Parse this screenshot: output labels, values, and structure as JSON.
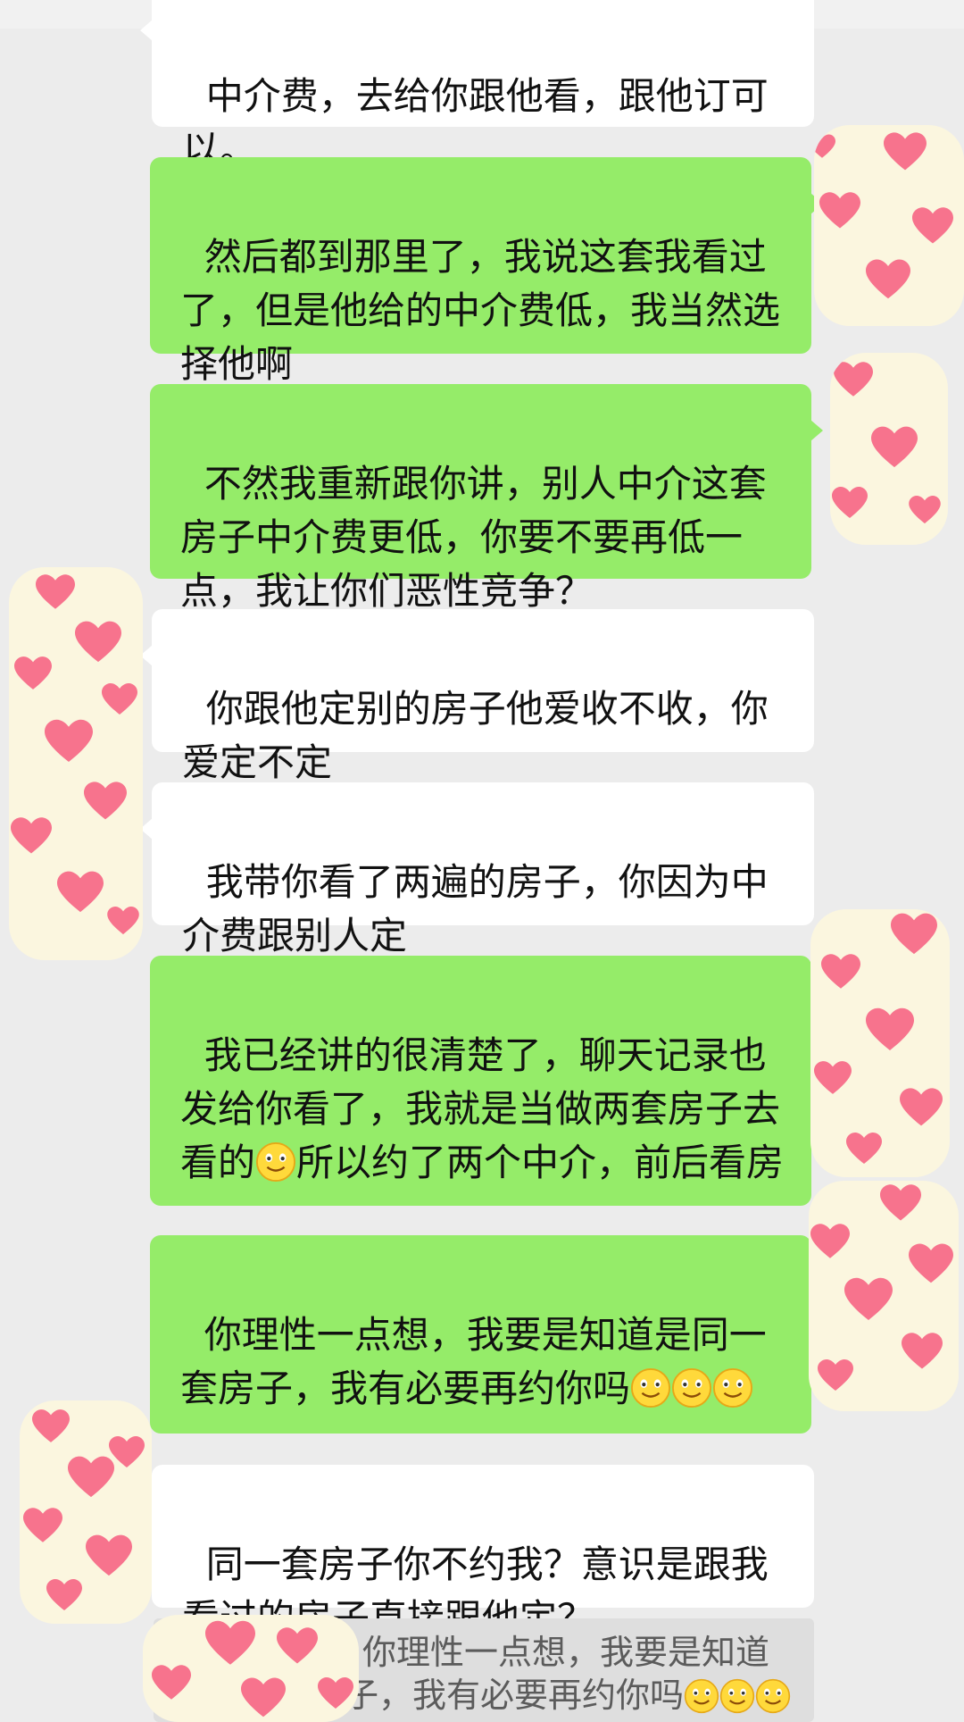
{
  "messages": [
    {
      "side": "left",
      "text": "中介费，去给你跟他看，跟他订可以。"
    },
    {
      "side": "right",
      "text": "然后都到那里了，我说这套我看过了，但是他给的中介费低，我当然选择他啊"
    },
    {
      "side": "right",
      "text": "不然我重新跟你讲，别人中介这套房子中介费更低，你要不要再低一点，我让你们恶性竞争？"
    },
    {
      "side": "left",
      "text": "你跟他定别的房子他爱收不收，你爱定不定"
    },
    {
      "side": "left",
      "text": "我带你看了两遍的房子，你因为中介费跟别人定"
    },
    {
      "side": "right",
      "text_before_emoji": "我已经讲的很清楚了，聊天记录也发给你看了，我就是当做两套房子去看的",
      "text_after_emoji": "所以约了两个中介，前后看房"
    },
    {
      "side": "right",
      "text": "你理性一点想，我要是知道是同一套房子，我有必要再约你吗"
    },
    {
      "side": "left",
      "text": "同一套房子你不约我？意识是跟我看过的房子直接跟他定？"
    }
  ],
  "quote": {
    "line1": "你理性一点想，我要是知道",
    "line2": "是同一套房子，我有必要再约你吗"
  },
  "icons": {
    "smile_emoji": "slightly-smiling-face-emoji",
    "sticker": "pink-hearts-sticker"
  },
  "colors": {
    "background": "#ececec",
    "incoming_bubble": "#ffffff",
    "outgoing_bubble": "#95ec69",
    "heart": "#f7738d",
    "sticker_bg": "#fbf6df"
  }
}
